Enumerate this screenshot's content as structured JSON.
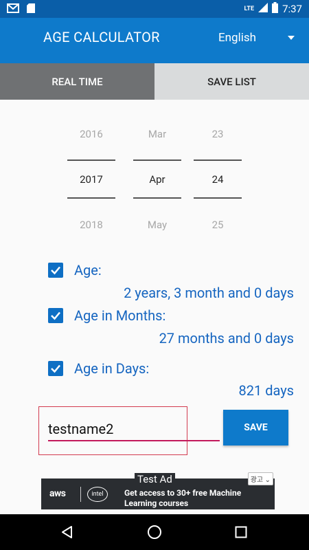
{
  "status_bar": {
    "time": "7:37",
    "network": "LTE"
  },
  "app_bar": {
    "title": "AGE CALCULATOR",
    "language": "English"
  },
  "tabs": [
    {
      "label": "REAL TIME",
      "active": true
    },
    {
      "label": "SAVE LIST",
      "active": false
    }
  ],
  "date_picker": {
    "year": {
      "prev": "2016",
      "selected": "2017",
      "next": "2018"
    },
    "month": {
      "prev": "Mar",
      "selected": "Apr",
      "next": "May"
    },
    "day": {
      "prev": "23",
      "selected": "24",
      "next": "25"
    }
  },
  "results": {
    "age": {
      "label": "Age:",
      "value": "2 years, 3 month and 0 days",
      "checked": true
    },
    "months": {
      "label": "Age in Months:",
      "value": "27 months and 0 days",
      "checked": true
    },
    "days": {
      "label": "Age in Days:",
      "value": "821 days",
      "checked": true
    }
  },
  "name_input": {
    "value": "testname2"
  },
  "save_button": {
    "label": "SAVE"
  },
  "ad": {
    "tag": "Test Ad",
    "choice": "광고",
    "brand_aws": "aws",
    "brand_intel": "intel",
    "text": "Get access to 30+ free Machine Learning courses"
  },
  "colors": {
    "accent": "#0e7acb",
    "status_bar": "#0a5ea8",
    "label_blue": "#1565c0",
    "active_tab": "#6f7173",
    "inactive_tab": "#d9dbdc"
  }
}
